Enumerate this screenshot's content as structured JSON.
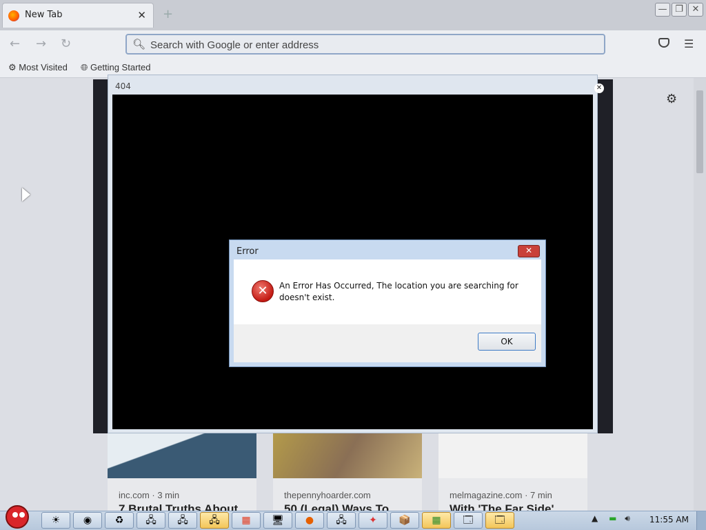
{
  "browser": {
    "tab_title": "New Tab",
    "url_placeholder": "Search with Google or enter address",
    "bookmarks": [
      {
        "label": "Most Visited"
      },
      {
        "label": "Getting Started"
      }
    ]
  },
  "popup": {
    "title": "404"
  },
  "dialog": {
    "title": "Error",
    "message": "An Error Has Occurred, The location you are searching for doesn't exist.",
    "ok_label": "OK"
  },
  "cards": [
    {
      "source": "inc.com · 3 min",
      "headline": "7 Brutal Truths About"
    },
    {
      "source": "thepennyhoarder.com",
      "headline": "50 (Legal) Ways To"
    },
    {
      "source": "melmagazine.com · 7 min",
      "headline": "With 'The Far Side'"
    }
  ],
  "taskbar": {
    "clock": "11:55 AM"
  }
}
